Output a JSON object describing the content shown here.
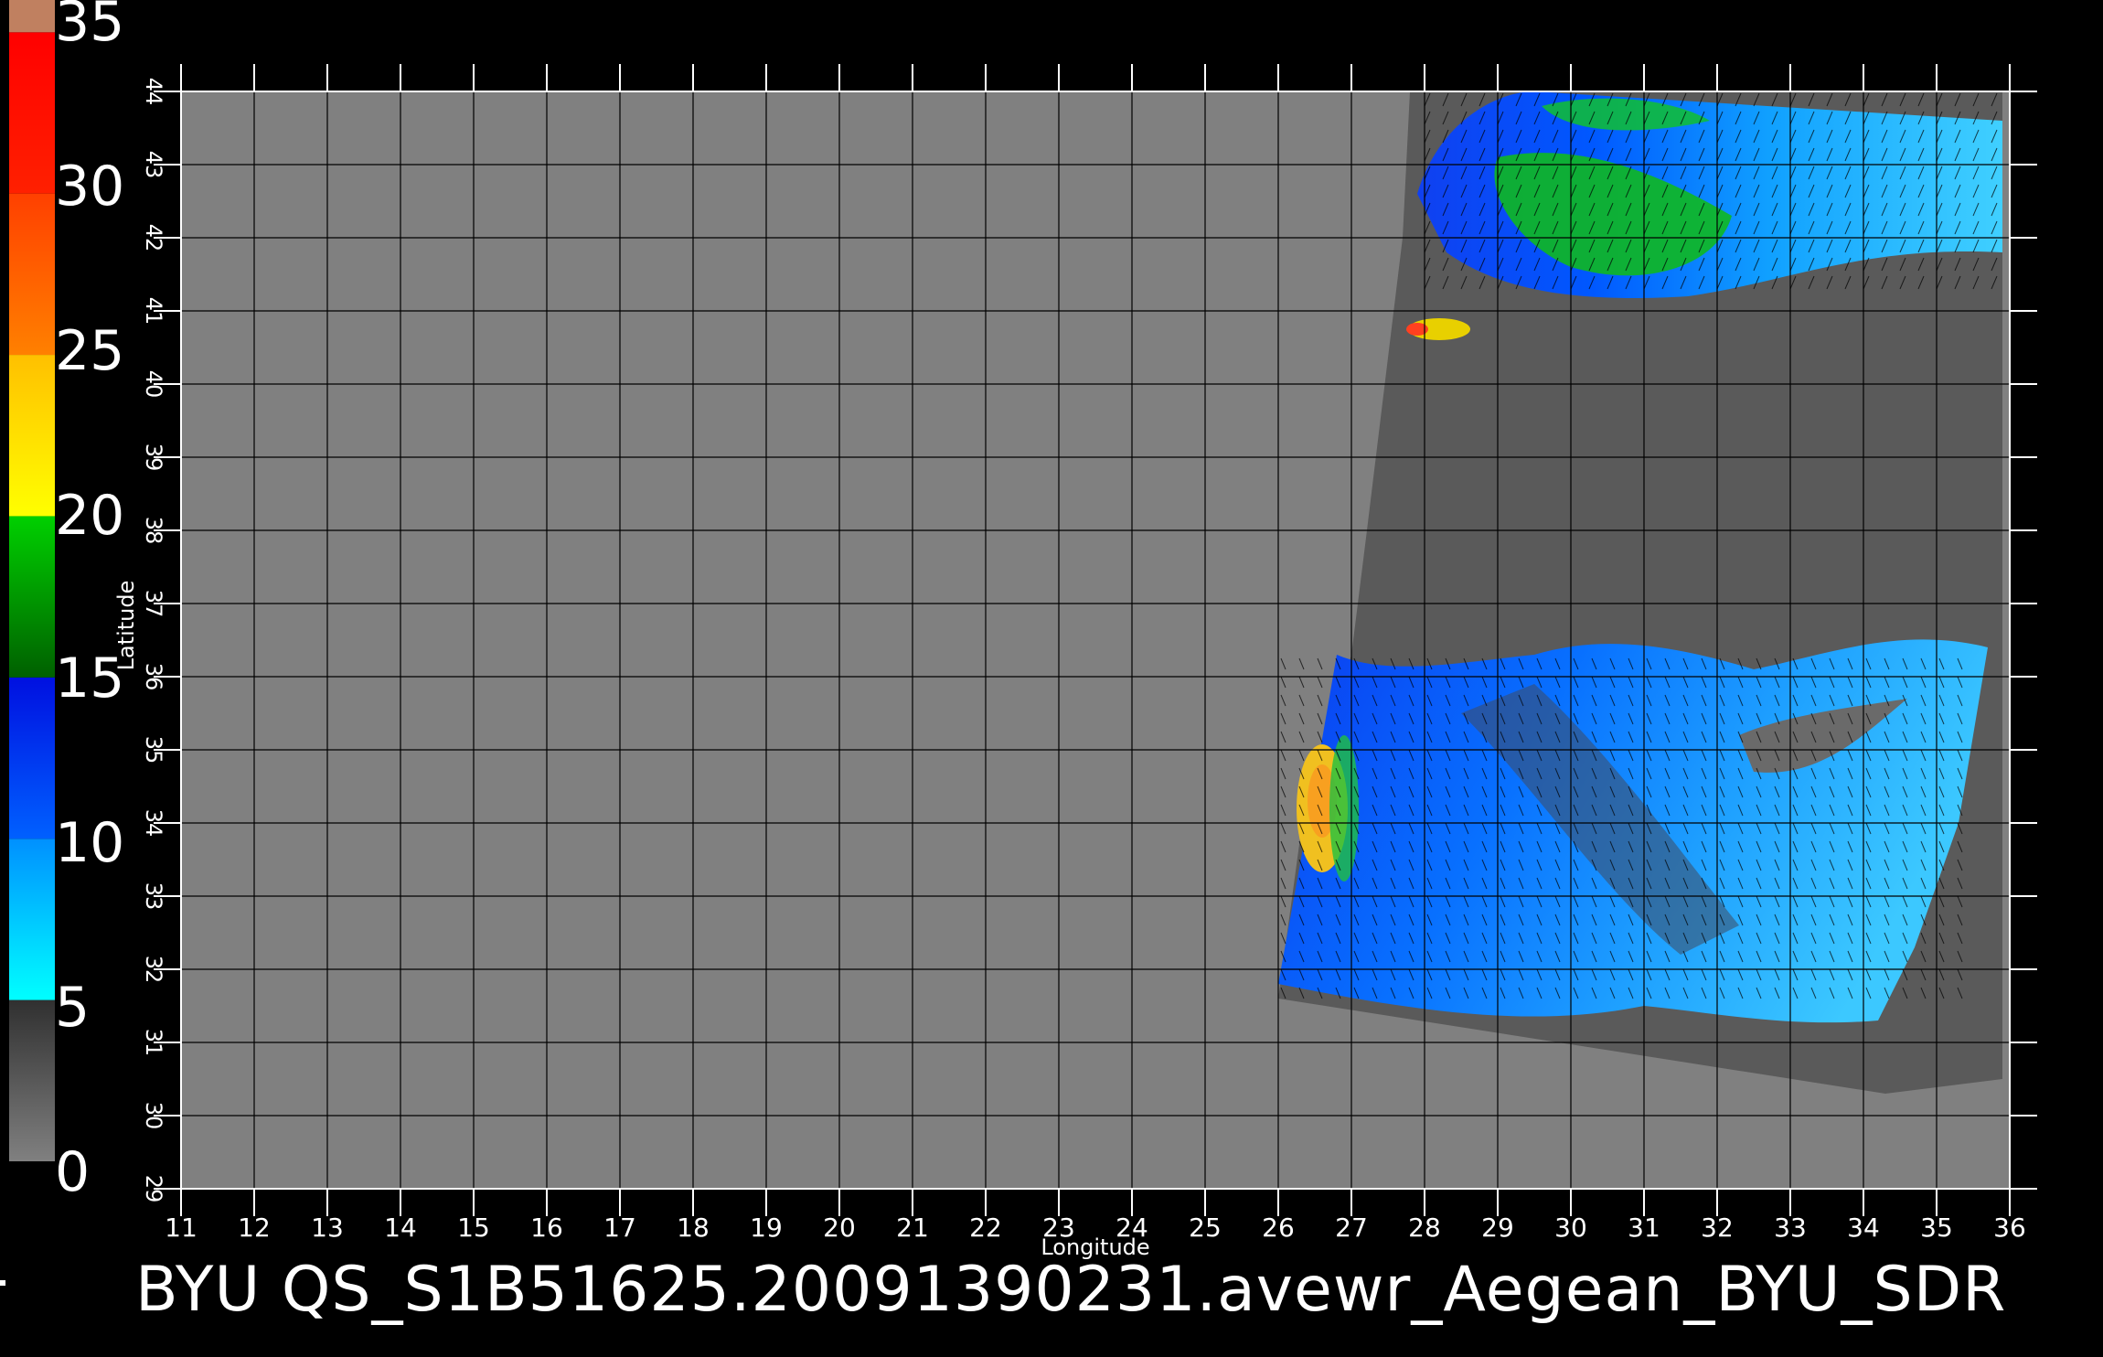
{
  "title": "BYU  QS_S1B51625.20091390231.avewr_Aegean_BYU_SDR",
  "xlabel": "Longitude",
  "ylabel": "Latitude",
  "longitude_ticks": [
    "11",
    "12",
    "13",
    "14",
    "15",
    "16",
    "17",
    "18",
    "19",
    "20",
    "21",
    "22",
    "23",
    "24",
    "25",
    "26",
    "27",
    "28",
    "29",
    "30",
    "31",
    "32",
    "33",
    "34",
    "35",
    "36"
  ],
  "latitude_ticks": [
    "29",
    "30",
    "31",
    "32",
    "33",
    "34",
    "35",
    "36",
    "37",
    "38",
    "39",
    "40",
    "41",
    "42",
    "43",
    "44"
  ],
  "colorbar": {
    "labels": [
      "35",
      "30",
      "25",
      "20",
      "15",
      "10",
      "5",
      "0"
    ],
    "segments": [
      {
        "from": 0,
        "to": 5,
        "colors": [
          "#808080",
          "#303030"
        ]
      },
      {
        "from": 5,
        "to": 10,
        "colors": [
          "#00ffff",
          "#0090ff"
        ]
      },
      {
        "from": 10,
        "to": 15,
        "colors": [
          "#0060ff",
          "#0010e0"
        ]
      },
      {
        "from": 15,
        "to": 20,
        "colors": [
          "#006000",
          "#00d000"
        ]
      },
      {
        "from": 20,
        "to": 25,
        "colors": [
          "#ffff00",
          "#ffc000"
        ]
      },
      {
        "from": 25,
        "to": 30,
        "colors": [
          "#ff8000",
          "#ff4000"
        ]
      },
      {
        "from": 30,
        "to": 35,
        "colors": [
          "#ff2000",
          "#ff0000"
        ]
      },
      {
        "from": 35,
        "to": 36,
        "colors": [
          "#c08060",
          "#c08060"
        ]
      }
    ]
  },
  "colors": {
    "no_data": "#808080",
    "land": "#555555",
    "swath_edge": "#6a6a6a",
    "grid": "#000000",
    "frame": "#ffffff"
  },
  "map": {
    "lon_range": [
      11,
      36
    ],
    "lat_range": [
      29,
      44
    ]
  }
}
